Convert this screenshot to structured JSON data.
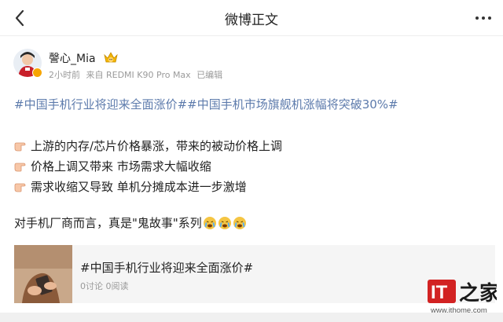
{
  "navbar": {
    "title": "微博正文",
    "back_icon": "chevron-left-icon",
    "more_icon": "more-dots-icon"
  },
  "post": {
    "author": {
      "name": "謦心_Mia",
      "badge_icon": "crown-emoji-icon",
      "verified_color": "#f7a500"
    },
    "meta": {
      "time": "2小时前",
      "source": "来自 REDMI K90 Pro Max",
      "edited": "已编辑"
    },
    "topics": [
      "#中国手机行业将迎来全面涨价#",
      "#中国手机市场旗舰机涨幅将突破30%#"
    ],
    "bullets": [
      "上游的内存/芯片价格暴涨，带来的被动价格上调",
      "价格上调又带来 市场需求大幅收缩",
      "需求收缩又导致 单机分摊成本进一步激增"
    ],
    "closing": "对手机厂商而言，真是\"鬼故事\"系列",
    "closing_emojis": [
      "crying-face-icon",
      "crying-face-icon",
      "crying-face-icon"
    ]
  },
  "card": {
    "title": "#中国手机行业将迎来全面涨价#",
    "stats": "0讨论 0阅读"
  },
  "watermark": {
    "logo_letters": "IT",
    "logo_char": "之家",
    "url": "www.ithome.com",
    "brand_color": "#d22222"
  },
  "colors": {
    "topic": "#5d7bac",
    "text": "#222222",
    "meta": "#9a9a9a"
  }
}
